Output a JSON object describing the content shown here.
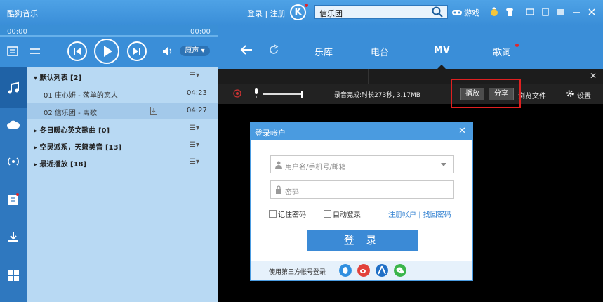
{
  "app": {
    "title": "酷狗音乐"
  },
  "topbar": {
    "login_text": "登录 | 注册",
    "k_logo": "K",
    "search_value": "信乐团",
    "games_label": "游戏"
  },
  "player": {
    "time_current": "00:00",
    "time_total": "00:00",
    "sound_mode": "原声 ▾"
  },
  "nav": {
    "tabs": [
      {
        "label": "乐库"
      },
      {
        "label": "电台"
      },
      {
        "label": "MV",
        "active": true
      },
      {
        "label": "歌词"
      }
    ]
  },
  "playlist": {
    "groups": [
      {
        "label": "▾ 默认列表 [2]",
        "menu": "☰▾"
      },
      {
        "label": "▸ 冬日暖心英文歌曲 [0]",
        "menu": "☰▾"
      },
      {
        "label": "▸ 空灵派系，天籁美音 [13]",
        "menu": "☰▾"
      },
      {
        "label": "▸ 最近播放 [18]",
        "menu": "☰▾"
      }
    ],
    "songs": [
      {
        "label": "01  庄心妍 - 落单的恋人",
        "time": "04:23"
      },
      {
        "label": "02  信乐团 - 离歌",
        "time": "04:27"
      }
    ]
  },
  "mv_toolbar": {
    "record_status": "录音完成:时长273秒, 3.17MB",
    "play_button": "播放",
    "share_button": "分享",
    "browse_files": "浏览文件",
    "settings": "设置",
    "close": "✕"
  },
  "login_dialog": {
    "title": "登录帐户",
    "close": "✕",
    "username_placeholder": "用户名/手机号/邮箱",
    "password_placeholder": "密码",
    "remember_password": "记住密码",
    "auto_login": "自动登录",
    "register": "注册帐户",
    "separator": "|",
    "recover": "找回密码",
    "login_button": "登 录",
    "third_party_text": "使用第三方帐号登录"
  },
  "colors": {
    "accent": "#3a8ed8",
    "highlight_border": "#e02020",
    "dialog_header": "#4a9be0"
  }
}
